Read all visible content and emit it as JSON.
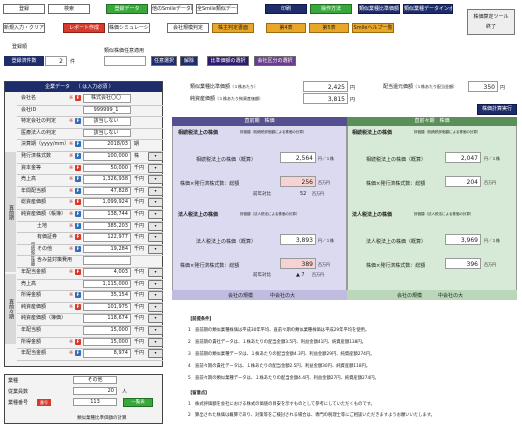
{
  "toolbar_row1": [
    {
      "label": "登録"
    },
    {
      "label": "検索"
    },
    {
      "label": "登録データ"
    },
    {
      "label": "他のSmileデータ取込"
    },
    {
      "label": "全Smile類似データ"
    },
    {
      "label": "印刷"
    },
    {
      "label": "操作方法"
    },
    {
      "label": "類似業種比準価額計算"
    },
    {
      "label": "類似業種データインポート"
    }
  ],
  "toolbar_row2": [
    {
      "label": "新規入力・クリア"
    },
    {
      "label": "レポート作成"
    },
    {
      "label": "株価シミュレーション"
    },
    {
      "label": "会社規模判定"
    },
    {
      "label": "株主判定書面"
    },
    {
      "label": "第4表"
    },
    {
      "label": "第5表"
    },
    {
      "label": "Smileヘルプ一覧"
    }
  ],
  "tools_button": {
    "line1": "株価算定ツール",
    "line2": "終了"
  },
  "register_label": "登録順",
  "register_count_label": "登録済件数",
  "register_count": "2",
  "register_count_unit": "件",
  "similar_apply": {
    "label": "類似株価任意適用",
    "btn1": "任意選択",
    "btn2": "解除",
    "btn3": "比準価額の選択",
    "btn4": "会社区分の選択"
  },
  "corp_panel": {
    "title": "企業データ",
    "subtitle": "（ は入力必須 ）",
    "rows": [
      {
        "label": "会社名",
        "req": true,
        "value": "株式会社〇〇",
        "unit": ""
      },
      {
        "label": "会社ID",
        "req": false,
        "value": "999999_1",
        "unit": ""
      },
      {
        "label": "特定会社の判定",
        "req": true,
        "value": "該当しない",
        "unit": ""
      },
      {
        "label": "医療法人の判定",
        "req": false,
        "value": "該当しない",
        "unit": ""
      },
      {
        "label": "決算期（yyyy/mm）",
        "req": true,
        "value": "2018/03",
        "unit": "期"
      },
      {
        "label": "発行済株式数",
        "req": true,
        "value": "100,000",
        "unit": "株"
      },
      {
        "label": "資本金等",
        "req": true,
        "value": "50,000",
        "unit": "千円"
      },
      {
        "label": "売上高",
        "req": true,
        "value": "1,326,938",
        "unit": "千円"
      },
      {
        "label": "年間配当額",
        "req": true,
        "value": "47,828",
        "unit": "千円"
      },
      {
        "label": "総資産価額",
        "req": true,
        "value": "1,099,924",
        "unit": "千円"
      },
      {
        "label": "純資産価額（帳簿）",
        "req": true,
        "value": "138,744",
        "unit": "千円"
      },
      {
        "label": "土地",
        "req": true,
        "value": "385,203",
        "unit": "千円"
      },
      {
        "label": "有価証券",
        "req": true,
        "value": "122,977",
        "unit": "千円"
      },
      {
        "label": "その他",
        "req": true,
        "value": "19,284",
        "unit": "千円"
      },
      {
        "label": "含み益対策費用",
        "req": false,
        "value": "",
        "unit": ""
      },
      {
        "label": "年配当金額",
        "req": true,
        "value": "4,003",
        "unit": "千円"
      },
      {
        "label": "売上高",
        "req": false,
        "value": "1,115,000",
        "unit": "千円"
      },
      {
        "label": "所得金額",
        "req": true,
        "value": "35,154",
        "unit": "千円"
      },
      {
        "label": "純資産価額",
        "req": true,
        "value": "101,975",
        "unit": "千円"
      },
      {
        "label": "純資産価額（簿価）",
        "req": false,
        "value": "118,674",
        "unit": "千円"
      },
      {
        "label": "年配当額",
        "req": false,
        "value": "15,000",
        "unit": "千円"
      },
      {
        "label": "所得金額",
        "req": true,
        "value": "15,000",
        "unit": "千円"
      },
      {
        "label": "年配当金額",
        "req": true,
        "value": "8,974",
        "unit": "千円"
      }
    ],
    "side_labels": {
      "current": "直前期",
      "prev": "直前々期"
    },
    "sub_labels": [
      "相続税評価額",
      "帳簿価額"
    ]
  },
  "bottom_panel": {
    "industry_label": "業種",
    "industry_value": "その他",
    "employees_label": "従業員数",
    "employees_value": "20",
    "employees_unit": "人",
    "code_label": "業種番号",
    "code_value": "113",
    "code_btn": "一覧表",
    "code_tag": "番号",
    "code_sub": "業種番号",
    "footer": "類似業種比準価額の計算"
  },
  "summary": {
    "ratio_label": "類似業種比準価額",
    "ratio_sub": "（１株あたり）",
    "ratio_value": "2,425",
    "ratio_unit": "円",
    "net_label": "純資産価額",
    "net_sub": "（１株あたり純資産価額）",
    "net_value": "3,815",
    "net_unit": "円",
    "div_label": "配当還元価額",
    "div_sub": "（１株あたり配当金額）",
    "div_value": "350",
    "div_unit": "円",
    "calc_btn": "株価計算実行"
  },
  "compare": {
    "left_header": "直前期　株価",
    "right_header": "直前々期　株価",
    "a_title": "相続税法上の株価",
    "a_note": "評価額（相続税評価額による株価の計算）",
    "row1_label": "相続税法上の株価（概算）",
    "left_v1": "2,564",
    "right_v1": "2,047",
    "unit1": "円／１株",
    "row2_label": "株価×発行済株式数：総額",
    "left_v2": "256",
    "right_v2": "204",
    "unit2": "百万円",
    "left_diff_label": "前年対比",
    "left_diff": "52",
    "diff_unit": "百万円",
    "b_title": "法人税法上の株価",
    "b_note": "評価額（法人税法による株価の計算）",
    "row3_label": "法人税法上の株価（概算）",
    "left_v3": "3,893",
    "right_v3": "3,969",
    "unit3": "円／１株",
    "row4_label": "株価×発行済株式数：総額",
    "left_v4": "389",
    "right_v4": "396",
    "unit4": "百万円",
    "left_diff2_label": "前年対比",
    "left_diff2": "▲ 7",
    "diff2_unit": "百万円",
    "size_left": "会社の規模",
    "size_left_value": "中会社の大",
    "size_right": "会社の規模",
    "size_right_value": "中会社の大"
  },
  "notes": {
    "title1": "【前提条件】",
    "lines1": [
      "1　直前期の類似業種株価は平成30年平均、直前々期の類似業種株価は平成29年平均を使用。",
      "2　直前期の貴社データは、１株あたりの配当金額3.5円、利益金額41円、純資産額138円。",
      "3　直前期の類似業種データは、１株あたりの配当金額4.3円、利益金額29円、純資産額274円。",
      "4　直前々期の貴社データは、１株あたりの配当金額2.5円、利益金額30円、純資産額118円。",
      "5　直前々期の類似業種データは、１株あたりの配当金額4.4円、利益金額27円、純資産額274円。"
    ],
    "title2": "【留意点】",
    "lines2": [
      "1　株式評価額を会社における株式の価値の目安を示すものとして参考にしていただくものです。",
      "2　算出された株価は概算であり、対策等をご検討される場合は、専門の税理士等にご相談いただきますようお願いいたします。"
    ]
  },
  "colors": {
    "accent": "#1d2c6b",
    "green": "#38a83b",
    "lavender": "#dcdaf0",
    "mint": "#d7ead7"
  }
}
